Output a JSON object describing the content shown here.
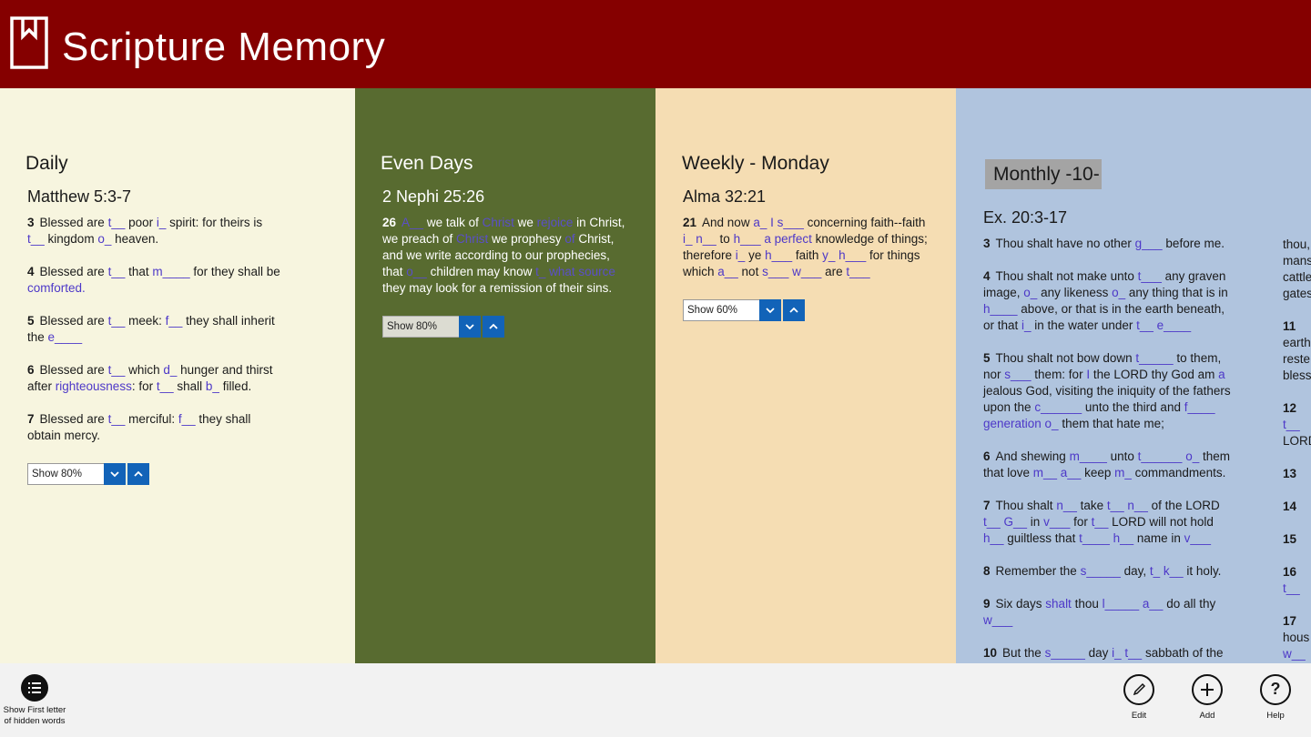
{
  "app": {
    "title": "Scripture Memory"
  },
  "panels": {
    "daily": {
      "title": "Daily",
      "reference": "Matthew 5:3-7",
      "show_label": "Show 80%",
      "color": "#f7f5df",
      "verses": [
        {
          "num": "3",
          "text": [
            [
              "t",
              "Blessed are "
            ],
            [
              "h",
              "t__"
            ],
            [
              "t",
              " poor "
            ],
            [
              "h",
              "i_"
            ],
            [
              "t",
              " spirit: for theirs is "
            ],
            [
              "h",
              "t__"
            ],
            [
              "t",
              " kingdom "
            ],
            [
              "h",
              "o_"
            ],
            [
              "t",
              " heaven."
            ]
          ]
        },
        {
          "num": "4",
          "text": [
            [
              "t",
              "Blessed are "
            ],
            [
              "h",
              "t__"
            ],
            [
              "t",
              " that "
            ],
            [
              "h",
              "m____"
            ],
            [
              "t",
              " for they shall be "
            ],
            [
              "h",
              "comforted."
            ]
          ]
        },
        {
          "num": "5",
          "text": [
            [
              "t",
              "Blessed are "
            ],
            [
              "h",
              "t__"
            ],
            [
              "t",
              " meek: "
            ],
            [
              "h",
              "f__"
            ],
            [
              "t",
              " they shall inherit the "
            ],
            [
              "h",
              "e____"
            ]
          ]
        },
        {
          "num": "6",
          "text": [
            [
              "t",
              "Blessed are "
            ],
            [
              "h",
              "t__"
            ],
            [
              "t",
              " which "
            ],
            [
              "h",
              "d_"
            ],
            [
              "t",
              " hunger and thirst after "
            ],
            [
              "h",
              "righteousness"
            ],
            [
              "t",
              ": for "
            ],
            [
              "h",
              "t__"
            ],
            [
              "t",
              " shall "
            ],
            [
              "h",
              "b_"
            ],
            [
              "t",
              " filled."
            ]
          ]
        },
        {
          "num": "7",
          "text": [
            [
              "t",
              "Blessed are "
            ],
            [
              "h",
              "t__"
            ],
            [
              "t",
              " merciful: "
            ],
            [
              "h",
              "f__"
            ],
            [
              "t",
              " they shall obtain mercy."
            ]
          ]
        }
      ]
    },
    "even": {
      "title": "Even Days",
      "reference": "2 Nephi 25:26",
      "show_label": "Show 80%",
      "color": "#586b30",
      "verses": [
        {
          "num": "26",
          "text": [
            [
              "h",
              "A__"
            ],
            [
              "t",
              " we talk of "
            ],
            [
              "h",
              "Christ"
            ],
            [
              "t",
              " we "
            ],
            [
              "h",
              "rejoice"
            ],
            [
              "t",
              " in Christ, we preach of "
            ],
            [
              "h",
              "Christ"
            ],
            [
              "t",
              " we prophesy "
            ],
            [
              "h",
              "of"
            ],
            [
              "t",
              " Christ, and we write according to our prophecies, that "
            ],
            [
              "h",
              "o__"
            ],
            [
              "t",
              " children may know "
            ],
            [
              "h",
              "t_ what source"
            ],
            [
              "t",
              " they may look for a remission of their sins."
            ]
          ]
        }
      ]
    },
    "weekly": {
      "title": "Weekly - Monday",
      "reference": "Alma 32:21",
      "show_label": "Show 60%",
      "color": "#f5ddb3",
      "verses": [
        {
          "num": "21",
          "text": [
            [
              "t",
              "And now "
            ],
            [
              "h",
              "a_ I s___"
            ],
            [
              "t",
              " concerning faith--faith "
            ],
            [
              "h",
              "i_ n__"
            ],
            [
              "t",
              " to "
            ],
            [
              "h",
              "h___ a perfect"
            ],
            [
              "t",
              " knowledge of things; therefore "
            ],
            [
              "h",
              "i_"
            ],
            [
              "t",
              " ye "
            ],
            [
              "h",
              "h___"
            ],
            [
              "t",
              " faith "
            ],
            [
              "h",
              "y_ h___"
            ],
            [
              "t",
              " for things which "
            ],
            [
              "h",
              "a__"
            ],
            [
              "t",
              " not "
            ],
            [
              "h",
              "s___ w___"
            ],
            [
              "t",
              " are "
            ],
            [
              "h",
              "t___"
            ]
          ]
        }
      ]
    },
    "monthly": {
      "title": "Monthly -10-",
      "reference": "Ex. 20:3-17",
      "color": "#b0c4de",
      "verses": [
        {
          "num": "3",
          "text": [
            [
              "t",
              "Thou shalt have no other "
            ],
            [
              "h",
              "g___"
            ],
            [
              "t",
              " before me."
            ]
          ]
        },
        {
          "num": "4",
          "text": [
            [
              "t",
              "Thou shalt not make unto "
            ],
            [
              "h",
              "t___"
            ],
            [
              "t",
              " any graven image, "
            ],
            [
              "h",
              "o_"
            ],
            [
              "t",
              " any likeness "
            ],
            [
              "h",
              "o_"
            ],
            [
              "t",
              " any thing that is in "
            ],
            [
              "h",
              "h____"
            ],
            [
              "t",
              " above, or that is in the earth beneath, or that "
            ],
            [
              "h",
              "i_"
            ],
            [
              "t",
              " in the water under "
            ],
            [
              "h",
              "t__ e____"
            ]
          ]
        },
        {
          "num": "5",
          "text": [
            [
              "t",
              "Thou shalt not bow down "
            ],
            [
              "h",
              "t_____"
            ],
            [
              "t",
              " to them, nor "
            ],
            [
              "h",
              "s___"
            ],
            [
              "t",
              " them: for "
            ],
            [
              "h",
              "I"
            ],
            [
              "t",
              " the LORD thy God am "
            ],
            [
              "h",
              "a"
            ],
            [
              "t",
              " jealous God, visiting the iniquity of the fathers upon the "
            ],
            [
              "h",
              "c______"
            ],
            [
              "t",
              " unto the third and "
            ],
            [
              "h",
              "f____ generation o_"
            ],
            [
              "t",
              " them that hate me;"
            ]
          ]
        },
        {
          "num": "6",
          "text": [
            [
              "t",
              "And shewing "
            ],
            [
              "h",
              "m____"
            ],
            [
              "t",
              " unto "
            ],
            [
              "h",
              "t______ o_"
            ],
            [
              "t",
              " them that love "
            ],
            [
              "h",
              "m__ a__"
            ],
            [
              "t",
              " keep "
            ],
            [
              "h",
              "m_"
            ],
            [
              "t",
              " commandments."
            ]
          ]
        },
        {
          "num": "7",
          "text": [
            [
              "t",
              "Thou shalt "
            ],
            [
              "h",
              "n__"
            ],
            [
              "t",
              " take "
            ],
            [
              "h",
              "t__ n__"
            ],
            [
              "t",
              " of the LORD "
            ],
            [
              "h",
              "t__ G__"
            ],
            [
              "t",
              " in "
            ],
            [
              "h",
              "v___"
            ],
            [
              "t",
              " for "
            ],
            [
              "h",
              "t__"
            ],
            [
              "t",
              " LORD will not hold "
            ],
            [
              "h",
              "h__"
            ],
            [
              "t",
              " guiltless that "
            ],
            [
              "h",
              "t____ h__"
            ],
            [
              "t",
              " name in "
            ],
            [
              "h",
              "v___"
            ]
          ]
        },
        {
          "num": "8",
          "text": [
            [
              "t",
              "Remember the "
            ],
            [
              "h",
              "s_____"
            ],
            [
              "t",
              " day, "
            ],
            [
              "h",
              "t_ k__"
            ],
            [
              "t",
              " it holy."
            ]
          ]
        },
        {
          "num": "9",
          "text": [
            [
              "t",
              "Six days "
            ],
            [
              "h",
              "shalt"
            ],
            [
              "t",
              " thou "
            ],
            [
              "h",
              "l_____ a__"
            ],
            [
              "t",
              " do all thy "
            ],
            [
              "h",
              "w___"
            ]
          ]
        },
        {
          "num": "10",
          "text": [
            [
              "t",
              "But the "
            ],
            [
              "h",
              "s_____"
            ],
            [
              "t",
              " day "
            ],
            [
              "h",
              "i_ t__"
            ],
            [
              "t",
              " sabbath of the"
            ]
          ]
        }
      ],
      "overflow_column": [
        {
          "lines": [
            [
              "t",
              "thou,"
            ],
            [
              "t",
              "mans"
            ],
            [
              "t",
              "cattle"
            ],
            [
              "t",
              "gates"
            ]
          ]
        },
        {
          "lines": [
            [
              "n",
              "11"
            ],
            [
              "t",
              "earth"
            ],
            [
              "t",
              "reste"
            ],
            [
              "t",
              "bless"
            ]
          ]
        },
        {
          "lines": [
            [
              "n",
              "12"
            ],
            [
              "h",
              "t__"
            ],
            [
              "t",
              "LORD"
            ]
          ]
        },
        {
          "lines": [
            [
              "n",
              "13"
            ]
          ]
        },
        {
          "lines": [
            [
              "n",
              "14"
            ]
          ]
        },
        {
          "lines": [
            [
              "n",
              "15"
            ]
          ]
        },
        {
          "lines": [
            [
              "n",
              "16"
            ],
            [
              "h",
              "t__"
            ]
          ]
        },
        {
          "lines": [
            [
              "n",
              "17"
            ],
            [
              "t",
              "hous"
            ],
            [
              "h",
              "w__"
            ]
          ]
        }
      ]
    }
  },
  "appbar": {
    "show_first_letter": "Show First letter of hidden words",
    "edit": "Edit",
    "add": "Add",
    "help": "Help"
  },
  "colors": {
    "titlebar": "#850000",
    "hidden_word": "#4d38c8",
    "arrow_button": "#1263b8"
  }
}
